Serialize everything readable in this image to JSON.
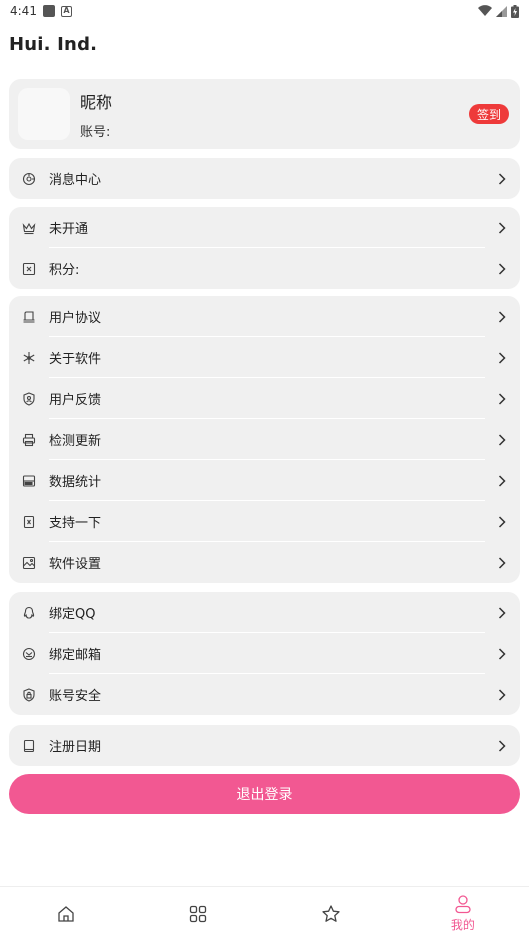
{
  "status_bar": {
    "time": "4:41",
    "a_badge": "A"
  },
  "app": {
    "title": "Hui. Ind."
  },
  "profile": {
    "nickname": "昵称",
    "account_label": "账号:",
    "checkin_label": "签到"
  },
  "groups": [
    {
      "items": [
        {
          "label": "消息中心",
          "icon": "message-icon"
        }
      ]
    },
    {
      "items": [
        {
          "label": "未开通",
          "icon": "crown-icon"
        },
        {
          "label": "积分:",
          "icon": "points-icon"
        }
      ]
    },
    {
      "items": [
        {
          "label": "用户协议",
          "icon": "agreement-icon"
        },
        {
          "label": "关于软件",
          "icon": "snowflake-icon"
        },
        {
          "label": "用户反馈",
          "icon": "shield-user-icon"
        },
        {
          "label": "检测更新",
          "icon": "printer-icon"
        },
        {
          "label": "数据统计",
          "icon": "stats-icon"
        },
        {
          "label": "支持一下",
          "icon": "support-icon"
        },
        {
          "label": "软件设置",
          "icon": "image-settings-icon"
        }
      ]
    },
    {
      "items": [
        {
          "label": "绑定QQ",
          "icon": "qq-icon"
        },
        {
          "label": "绑定邮箱",
          "icon": "mail-icon"
        },
        {
          "label": "账号安全",
          "icon": "shield-lock-icon"
        }
      ]
    },
    {
      "items": [
        {
          "label": "注册日期",
          "icon": "tablet-icon"
        }
      ]
    }
  ],
  "logout": {
    "label": "退出登录"
  },
  "nav": [
    {
      "icon": "home-icon"
    },
    {
      "icon": "grid-icon"
    },
    {
      "icon": "star-icon"
    },
    {
      "icon": "user-icon",
      "label": "我的",
      "active": true
    }
  ],
  "colors": {
    "accent": "#f25892",
    "badge": "#ee3a3a",
    "card": "#f0f0f0"
  }
}
